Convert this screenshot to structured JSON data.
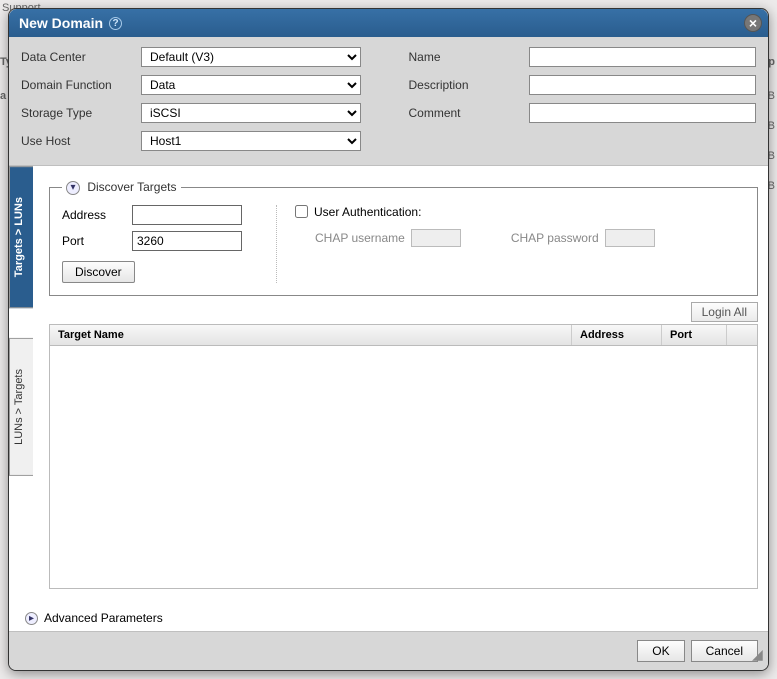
{
  "title": "New Domain",
  "labels": {
    "data_center": "Data Center",
    "domain_function": "Domain Function",
    "storage_type": "Storage Type",
    "use_host": "Use Host",
    "name": "Name",
    "description": "Description",
    "comment": "Comment"
  },
  "values": {
    "data_center": "Default (V3)",
    "domain_function": "Data",
    "storage_type": "iSCSI",
    "use_host": "Host1",
    "name": "",
    "description": "",
    "comment": ""
  },
  "tabs": {
    "targets_luns": "Targets > LUNs",
    "luns_targets": "LUNs > Targets"
  },
  "discover": {
    "legend": "Discover Targets",
    "address_label": "Address",
    "address_value": "",
    "port_label": "Port",
    "port_value": "3260",
    "button": "Discover",
    "user_auth": "User Authentication:",
    "chap_user": "CHAP username",
    "chap_pass": "CHAP password"
  },
  "login_all": "Login All",
  "table": {
    "target_name": "Target Name",
    "address": "Address",
    "port": "Port"
  },
  "advanced": "Advanced Parameters",
  "buttons": {
    "ok": "OK",
    "cancel": "Cancel"
  }
}
